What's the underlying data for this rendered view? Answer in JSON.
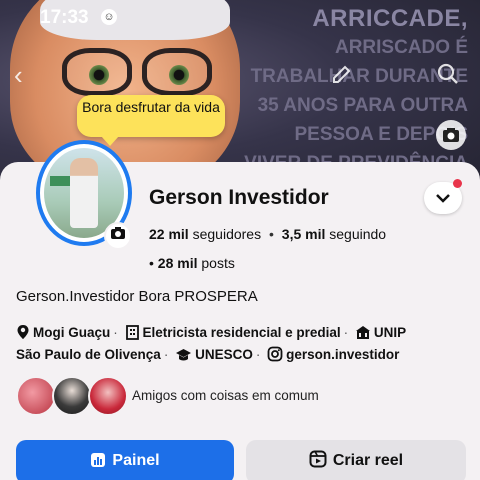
{
  "status_bar": {
    "time": "17:33"
  },
  "cover": {
    "text_lines": [
      "ARRICCADE,",
      "ARRISCADO É",
      "TRABALHAR DURANTE",
      "35 ANOS PARA OUTRA",
      "PESSOA E DEPOIS",
      "VIVER DE PREVIDÊNCIA"
    ]
  },
  "note_bubble": "Bora desfrutar da vida",
  "profile": {
    "name": "Gerson Investidor",
    "followers_count": "22 mil",
    "followers_label": "seguidores",
    "following_count": "3,5 mil",
    "following_label": "seguindo",
    "posts_count": "28 mil",
    "posts_label": "posts",
    "bio": "Gerson.Investidor Bora PROSPERA",
    "details": {
      "location": "Mogi Guaçu",
      "job": "Eletricista residencial e predial",
      "work_place": "UNIP",
      "hometown": "São Paulo de Olivença",
      "education": "UNESCO",
      "instagram": "gerson.investidor"
    },
    "friends_label": "Amigos com coisas em comum"
  },
  "actions": {
    "primary_label": "Painel",
    "secondary_label": "Criar reel"
  },
  "colors": {
    "accent": "#1d6fe8",
    "bubble": "#fde25a",
    "notification_dot": "#e8344b",
    "background": "#f4f1f3"
  },
  "icons": [
    "back-arrow-icon",
    "edit-pencil-icon",
    "search-icon",
    "camera-icon",
    "chevron-down-icon",
    "location-pin-icon",
    "work-building-icon",
    "workplace-icon",
    "education-cap-icon",
    "instagram-icon",
    "chart-icon",
    "reel-icon"
  ]
}
